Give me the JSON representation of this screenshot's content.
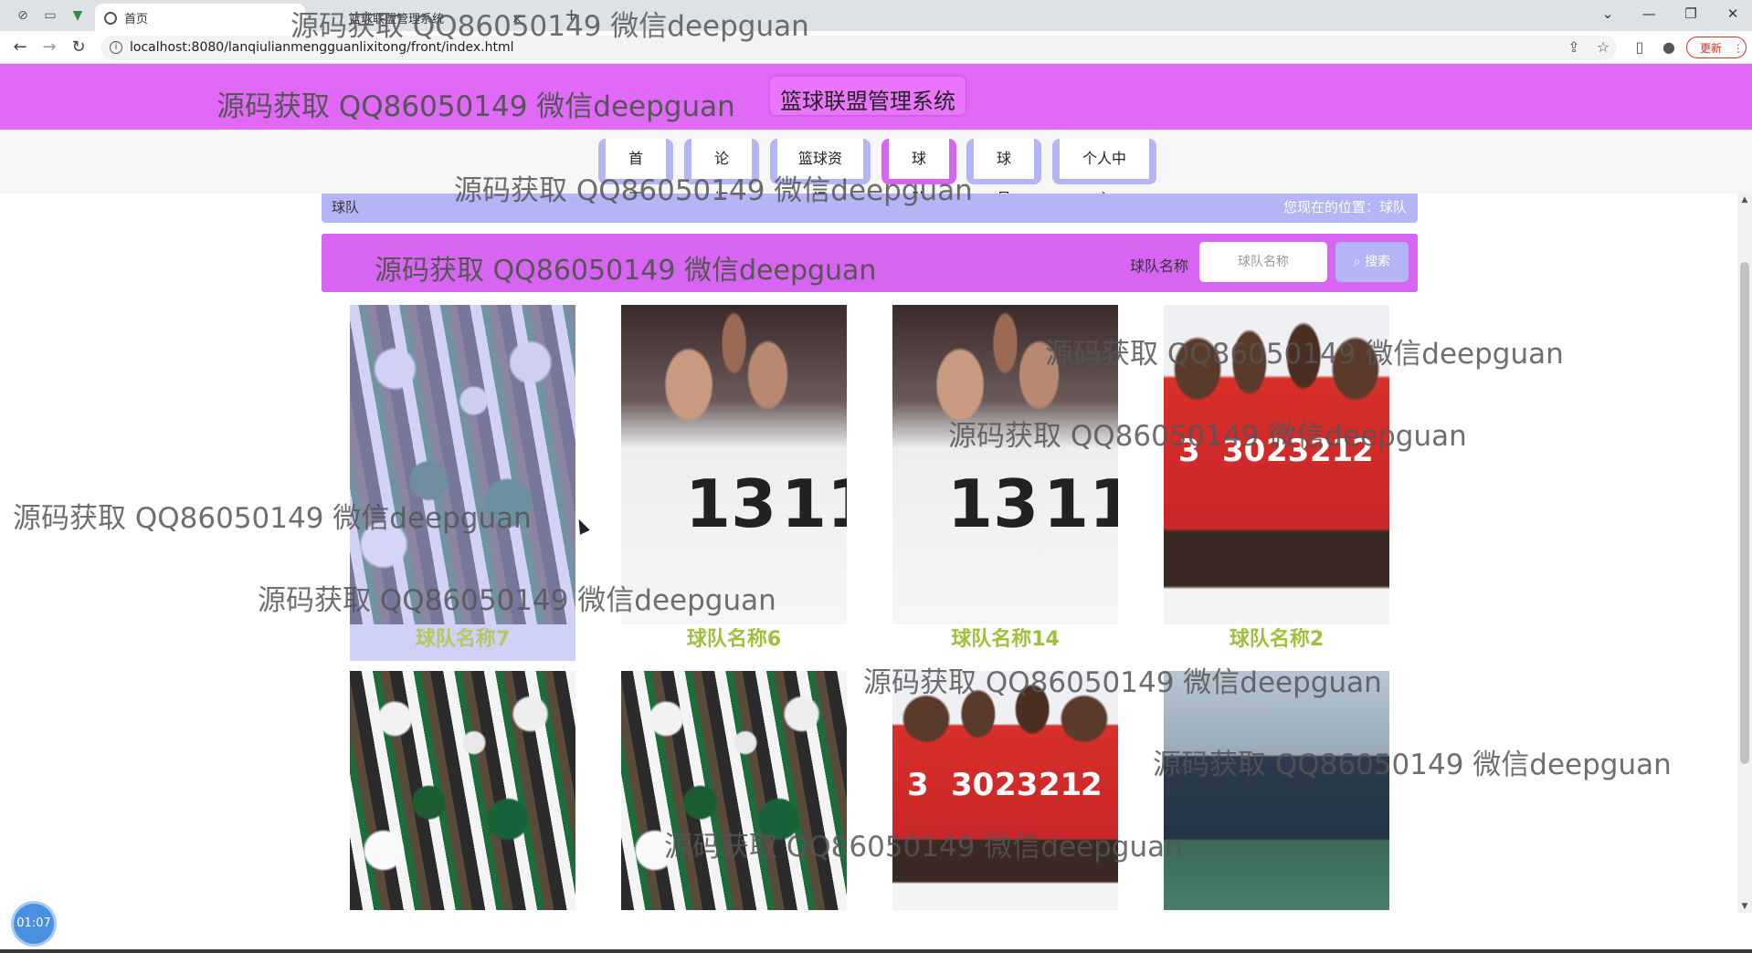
{
  "browser": {
    "tab_active_title": "首页",
    "tab_second_title": "篮球联盟管理系统",
    "tab_second_close": "×",
    "new_tab": "+",
    "url": "localhost:8080/lanqiulianmengguanlixitong/front/index.html",
    "update_label": "更新",
    "menu_glyph": "⋮",
    "back_glyph": "←",
    "forward_glyph": "→",
    "reload_glyph": "↻",
    "share_glyph": "⇪",
    "star_glyph": "☆",
    "sidepanel_glyph": "▯",
    "profile_glyph": "●",
    "chevron_glyph": "⌄",
    "minimize_glyph": "—",
    "restore_glyph": "❐",
    "close_glyph": "✕"
  },
  "header": {
    "site_title": "篮球联盟管理系统",
    "watermark": "源码获取 QQ86050149 微信deepguan"
  },
  "nav": {
    "items": [
      {
        "label": "首页"
      },
      {
        "label": "论坛"
      },
      {
        "label": "篮球资讯"
      },
      {
        "label": "球队"
      },
      {
        "label": "球员"
      },
      {
        "label": "个人中心"
      }
    ],
    "active": "球队"
  },
  "breadcrumb": {
    "title": "球队",
    "location": "您现在的位置：球队"
  },
  "search": {
    "watermark": "源码获取 QQ86050149 微信deepguan",
    "label": "球队名称",
    "placeholder": "球队名称",
    "button_icon": "⌕",
    "button_label": "搜索"
  },
  "teams": [
    {
      "name": "球队名称7",
      "photo": "celtics-celebration"
    },
    {
      "name": "球队名称6",
      "photo": "team-huddle"
    },
    {
      "name": "球队名称14",
      "photo": "team-huddle"
    },
    {
      "name": "球队名称2",
      "photo": "cavaliers-lineup"
    },
    {
      "name": "",
      "photo": "celtics-celebration"
    },
    {
      "name": "",
      "photo": "celtics-celebration"
    },
    {
      "name": "",
      "photo": "cavaliers-lineup"
    },
    {
      "name": "",
      "photo": "street-team"
    }
  ],
  "watermark_text": "源码获取 QQ86050149 微信deepguan",
  "timer": "01:07",
  "colors": {
    "header": "#e169f7",
    "accent_purple": "#d765f2",
    "periwinkle": "#b3b5f5",
    "team_name": "#9fc03a"
  }
}
